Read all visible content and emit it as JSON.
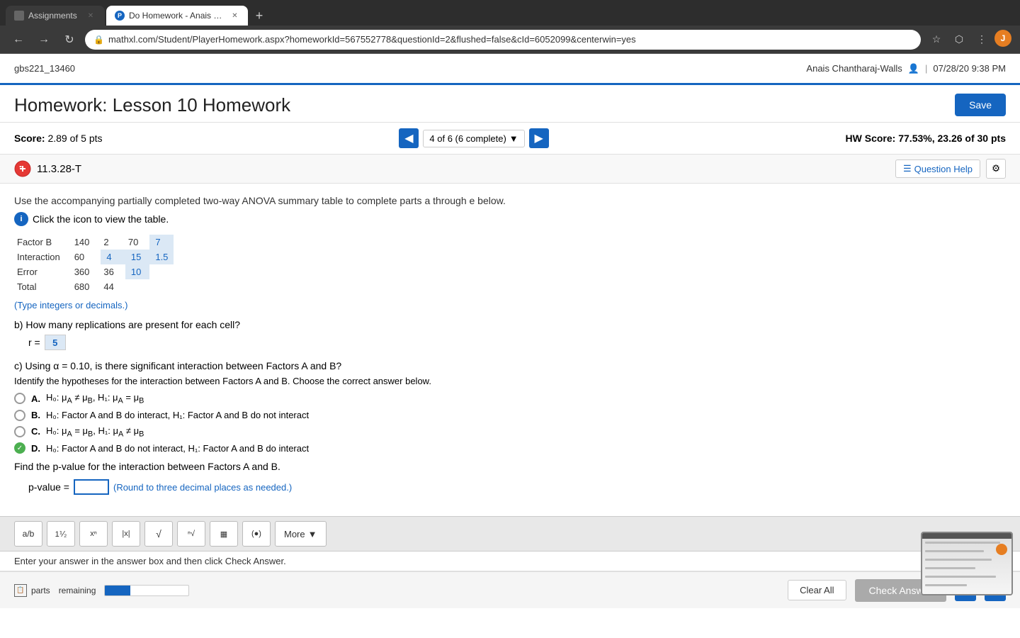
{
  "browser": {
    "tabs": [
      {
        "id": "assignments",
        "label": "Assignments",
        "active": false,
        "favicon": "grid"
      },
      {
        "id": "homework",
        "label": "Do Homework - Anais Chanth...",
        "active": true,
        "favicon": "P"
      }
    ],
    "url": "mathxl.com/Student/PlayerHomework.aspx?homeworkId=567552778&questionId=2&flushed=false&cId=6052099&centerwin=yes",
    "new_tab_icon": "+"
  },
  "app": {
    "brand": "gbs221_13460",
    "user": "Anais Chantharaj-Walls",
    "date": "07/28/20 9:38 PM"
  },
  "page": {
    "title": "Homework: Lesson 10 Homework",
    "save_label": "Save",
    "score_label": "Score:",
    "score_value": "2.89 of 5 pts",
    "question_nav": "4 of 6 (6 complete)",
    "hw_score_label": "HW Score:",
    "hw_score_value": "77.53%, 23.26 of 30 pts",
    "question_id": "11.3.28-T",
    "question_help_label": "Question Help",
    "instruction": "Use the accompanying partially completed two-way ANOVA summary table to complete parts a through e below.",
    "click_icon_text": "Click the icon to view the table.",
    "type_hint": "(Type integers or decimals.)"
  },
  "table": {
    "rows": [
      {
        "source": "Factor B",
        "ss": "140",
        "df": "2",
        "ms": "70",
        "f": "7"
      },
      {
        "source": "Interaction",
        "ss": "60",
        "df": "4",
        "ms": "15",
        "f": "1.5"
      },
      {
        "source": "Error",
        "ss": "360",
        "df": "36",
        "ms": "10",
        "f": ""
      },
      {
        "source": "Total",
        "ss": "680",
        "df": "44",
        "ms": "",
        "f": ""
      }
    ]
  },
  "part_b": {
    "label": "b)",
    "question": "How many replications are present for each cell?",
    "prefix": "r =",
    "answer": "5"
  },
  "part_c": {
    "label": "c)",
    "question": "Using α = 0.10, is there significant interaction between Factors A and B?",
    "sub_question": "Identify the hypotheses for the interaction between Factors A and B. Choose the correct answer below.",
    "options": [
      {
        "id": "A",
        "text": "H₀: μ_A ≠ μ_B, H₁: μ_A = μ_B",
        "selected": false,
        "correct": false
      },
      {
        "id": "B",
        "text": "H₀: Factor A and B do interact, H₁: Factor A and B do not interact",
        "selected": false,
        "correct": false
      },
      {
        "id": "C",
        "text": "H₀: μ_A = μ_B, H₁: μ_A ≠ μ_B",
        "selected": false,
        "correct": false
      },
      {
        "id": "D",
        "text": "H₀: Factor A and B do not interact, H₁: Factor A and B do interact",
        "selected": true,
        "correct": true
      }
    ],
    "pvalue_label": "Find the p-value for the interaction between Factors A and B.",
    "pvalue_prefix": "p-value =",
    "pvalue_hint": "(Round to three decimal places as needed.)"
  },
  "math_toolbar": {
    "buttons": [
      "fraction",
      "mixed-number",
      "exponent",
      "absolute-value",
      "sqrt",
      "nth-root",
      "matrix-2x2",
      "parentheses"
    ],
    "more_label": "More",
    "symbols": [
      "⁻¹⁄₂",
      "⁺∕₋",
      "ⁿ",
      "|x|",
      "√",
      "ⁿ√",
      "▦",
      "(◯)"
    ]
  },
  "footer": {
    "answer_instruction": "Enter your answer in the answer box and then click Check Answer.",
    "parts_label": "parts",
    "remaining_label": "remaining",
    "clear_all_label": "Clear All",
    "check_answer_label": "Check Answer"
  }
}
